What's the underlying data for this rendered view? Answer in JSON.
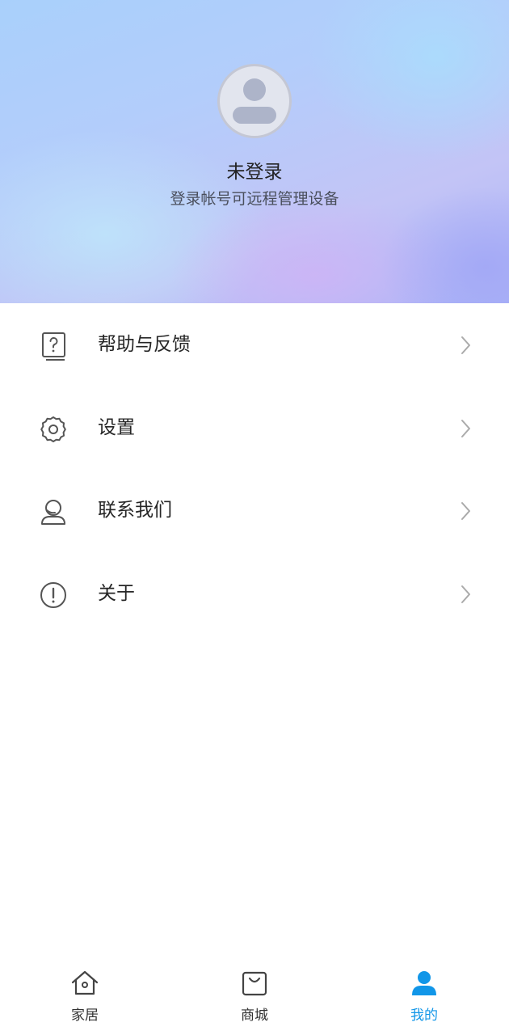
{
  "profile": {
    "title": "未登录",
    "subtitle": "登录帐号可远程管理设备"
  },
  "menu": {
    "items": [
      {
        "label": "帮助与反馈",
        "icon": "help-feedback-icon"
      },
      {
        "label": "设置",
        "icon": "gear-icon"
      },
      {
        "label": "联系我们",
        "icon": "customer-service-icon"
      },
      {
        "label": "关于",
        "icon": "info-icon"
      }
    ]
  },
  "bottom_nav": {
    "tabs": [
      {
        "label": "家居",
        "icon": "home-icon",
        "active": false
      },
      {
        "label": "商城",
        "icon": "shopping-bag-icon",
        "active": false
      },
      {
        "label": "我的",
        "icon": "person-icon",
        "active": true
      }
    ]
  },
  "colors": {
    "accent": "#1196e8",
    "text_primary": "#262626",
    "text_secondary": "#4a4f5c",
    "chevron": "#aaaaaa",
    "icon": "#555555"
  }
}
